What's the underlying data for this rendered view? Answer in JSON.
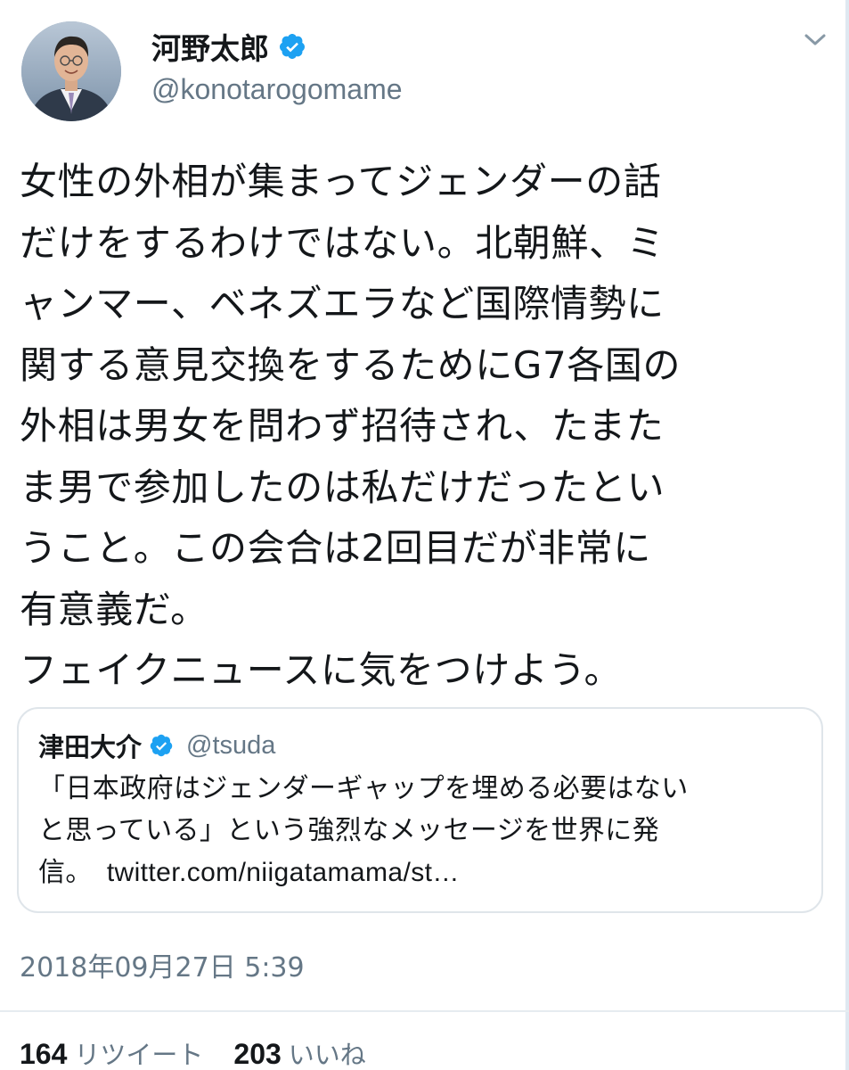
{
  "tweet": {
    "author": {
      "display_name": "河野太郎",
      "handle": "@konotarogomame",
      "verified": true
    },
    "text_lines": [
      "女性の外相が集まってジェンダーの話",
      "だけをするわけではない。北朝鮮、ミ",
      "ャンマー、ベネズエラなど国際情勢に",
      "関する意見交換をするためにG7各国の",
      "外相は男女を問わず招待され、たまた",
      "ま男で参加したのは私だけだったとい",
      "うこと。この会合は2回目だが非常に",
      "有意義だ。",
      "フェイクニュースに気をつけよう。"
    ],
    "quoted": {
      "display_name": "津田大介",
      "handle": "@tsuda",
      "verified": true,
      "text_lines": [
        "「日本政府はジェンダーギャップを埋める必要はない",
        "と思っている」という強烈なメッセージを世界に発",
        "信。"
      ],
      "link": "twitter.com/niigatamama/st…"
    },
    "timestamp": "2018年09月27日 5:39",
    "stats": {
      "retweets": "164",
      "retweets_label": "リツイート",
      "likes": "203",
      "likes_label": "いいね"
    }
  },
  "colors": {
    "text": "#14171a",
    "secondary": "#657786",
    "verified": "#1da1f2",
    "border": "#dfe5ea",
    "divider": "#e6ecf0"
  },
  "icons": {
    "verified": "verified-badge-icon",
    "caret": "chevron-down-icon"
  }
}
